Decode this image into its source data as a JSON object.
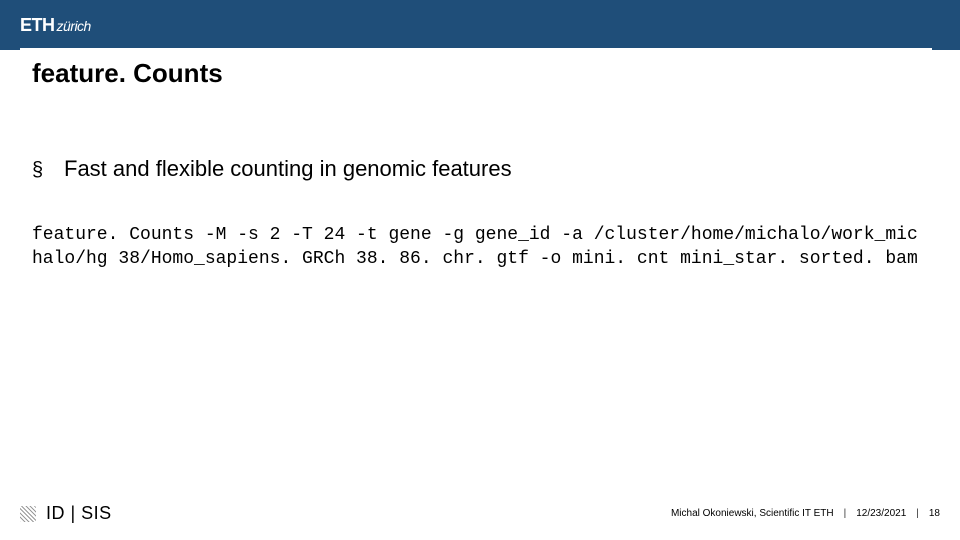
{
  "header": {
    "logo_main": "ETH",
    "logo_sub": "zürich"
  },
  "title": "feature. Counts",
  "bullet": {
    "marker": "§",
    "text": "Fast and flexible counting in genomic features"
  },
  "code": "feature. Counts -M -s 2 -T 24 -t gene -g gene_id -a /cluster/home/michalo/work_michalo/hg 38/Homo_sapiens. GRCh 38. 86. chr. gtf -o mini. cnt mini_star. sorted. bam",
  "footer": {
    "left_label": "ID | SIS",
    "author": "Michal Okoniewski, Scientific IT ETH",
    "date": "12/23/2021",
    "page": "18",
    "separator": "|"
  }
}
